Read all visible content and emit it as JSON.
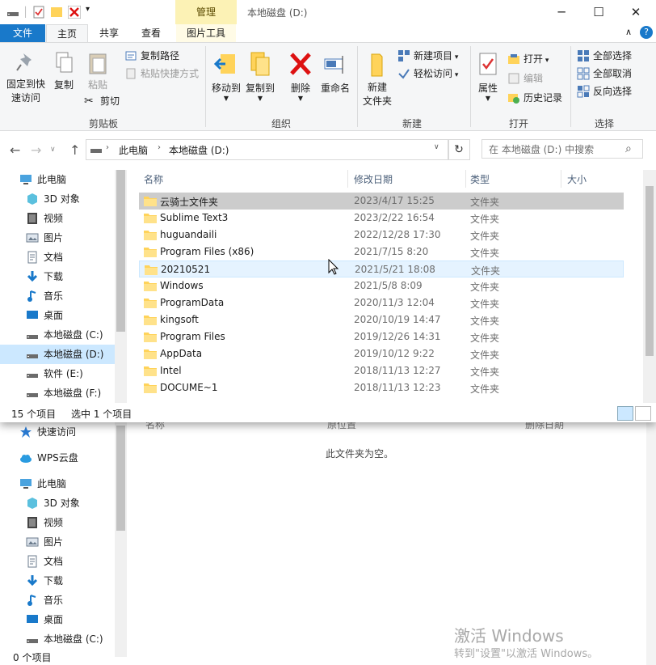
{
  "qat": {
    "icons": [
      "drive-icon",
      "properties-check-icon",
      "folder-icon",
      "delete-x-icon",
      "dropdown-arrow-icon"
    ]
  },
  "window": {
    "title": "本地磁盘 (D:)",
    "tool_tab_header": "管理",
    "minimize": "─",
    "maximize": "☐",
    "close": "✕",
    "help": "?",
    "collapse": "∧"
  },
  "tabs": {
    "file": "文件",
    "home": "主页",
    "share": "共享",
    "view": "查看",
    "picture_tools": "图片工具"
  },
  "ribbon": {
    "clipboard": {
      "label": "剪贴板",
      "pin": "固定到快\n速访问",
      "copy": "复制",
      "paste": "粘贴",
      "copy_path": "复制路径",
      "paste_shortcut": "粘贴快捷方式",
      "cut": "剪切"
    },
    "organize": {
      "label": "组织",
      "move_to": "移动到",
      "copy_to": "复制到",
      "delete": "删除",
      "rename": "重命名"
    },
    "new": {
      "label": "新建",
      "new_folder": "新建\n文件夹",
      "new_item": "新建项目",
      "easy_access": "轻松访问"
    },
    "open": {
      "label": "打开",
      "properties": "属性",
      "open": "打开",
      "edit": "编辑",
      "history": "历史记录"
    },
    "select": {
      "label": "选择",
      "select_all": "全部选择",
      "select_none": "全部取消",
      "invert": "反向选择"
    }
  },
  "address": {
    "crumb1": "此电脑",
    "crumb2": "本地磁盘 (D:)",
    "search_placeholder": "在 本地磁盘 (D:) 中搜索",
    "refresh": "↻"
  },
  "nav": {
    "items": [
      {
        "label": "此电脑",
        "icon": "pc-icon"
      },
      {
        "label": "3D 对象",
        "icon": "3d-objects-icon"
      },
      {
        "label": "视频",
        "icon": "video-icon"
      },
      {
        "label": "图片",
        "icon": "pictures-icon"
      },
      {
        "label": "文档",
        "icon": "documents-icon"
      },
      {
        "label": "下载",
        "icon": "download-icon"
      },
      {
        "label": "音乐",
        "icon": "music-icon"
      },
      {
        "label": "桌面",
        "icon": "desktop-icon"
      },
      {
        "label": "本地磁盘 (C:)",
        "icon": "drive-icon"
      },
      {
        "label": "本地磁盘 (D:)",
        "icon": "drive-icon"
      },
      {
        "label": "软件 (E:)",
        "icon": "drive-icon"
      },
      {
        "label": "本地磁盘 (F:)",
        "icon": "drive-icon"
      }
    ]
  },
  "columns": {
    "name": "名称",
    "modified": "修改日期",
    "type": "类型",
    "size": "大小"
  },
  "files": [
    {
      "name": "云骑士文件夹",
      "date": "2023/4/17 15:25",
      "type": "文件夹"
    },
    {
      "name": "Sublime Text3",
      "date": "2023/2/22 16:54",
      "type": "文件夹"
    },
    {
      "name": "huguandaili",
      "date": "2022/12/28 17:30",
      "type": "文件夹"
    },
    {
      "name": "Program Files (x86)",
      "date": "2021/7/15 8:20",
      "type": "文件夹"
    },
    {
      "name": "20210521",
      "date": "2021/5/21 18:08",
      "type": "文件夹"
    },
    {
      "name": "Windows",
      "date": "2021/5/8 8:09",
      "type": "文件夹"
    },
    {
      "name": "ProgramData",
      "date": "2020/11/3 12:04",
      "type": "文件夹"
    },
    {
      "name": "kingsoft",
      "date": "2020/10/19 14:47",
      "type": "文件夹"
    },
    {
      "name": "Program Files",
      "date": "2019/12/26 14:31",
      "type": "文件夹"
    },
    {
      "name": "AppData",
      "date": "2019/10/12 9:22",
      "type": "文件夹"
    },
    {
      "name": "Intel",
      "date": "2018/11/13 12:27",
      "type": "文件夹"
    },
    {
      "name": "DOCUME~1",
      "date": "2018/11/13 12:23",
      "type": "文件夹"
    }
  ],
  "status": {
    "count": "15 个项目",
    "selected": "选中 1 个项目"
  },
  "bg": {
    "col_name": "名称",
    "col_orig": "原位置",
    "col_deleted": "删除日期",
    "empty": "此文件夹为空。",
    "nav": [
      {
        "label": "快速访问",
        "icon": "star-icon"
      },
      {
        "label": "WPS云盘",
        "icon": "cloud-icon"
      },
      {
        "label": "此电脑",
        "icon": "pc-icon"
      },
      {
        "label": "3D 对象",
        "icon": "3d-objects-icon"
      },
      {
        "label": "视频",
        "icon": "video-icon"
      },
      {
        "label": "图片",
        "icon": "pictures-icon"
      },
      {
        "label": "文档",
        "icon": "documents-icon"
      },
      {
        "label": "下载",
        "icon": "download-icon"
      },
      {
        "label": "音乐",
        "icon": "music-icon"
      },
      {
        "label": "桌面",
        "icon": "desktop-icon"
      },
      {
        "label": "本地磁盘 (C:)",
        "icon": "drive-icon"
      }
    ],
    "status": "0 个项目",
    "watermark_title": "激活 Windows",
    "watermark_sub": "转到\"设置\"以激活 Windows。"
  },
  "colors": {
    "accent": "#1979ca",
    "selected": "#cce8ff",
    "folder": "#ffd35a",
    "tool_tab": "#fcf2b5"
  }
}
